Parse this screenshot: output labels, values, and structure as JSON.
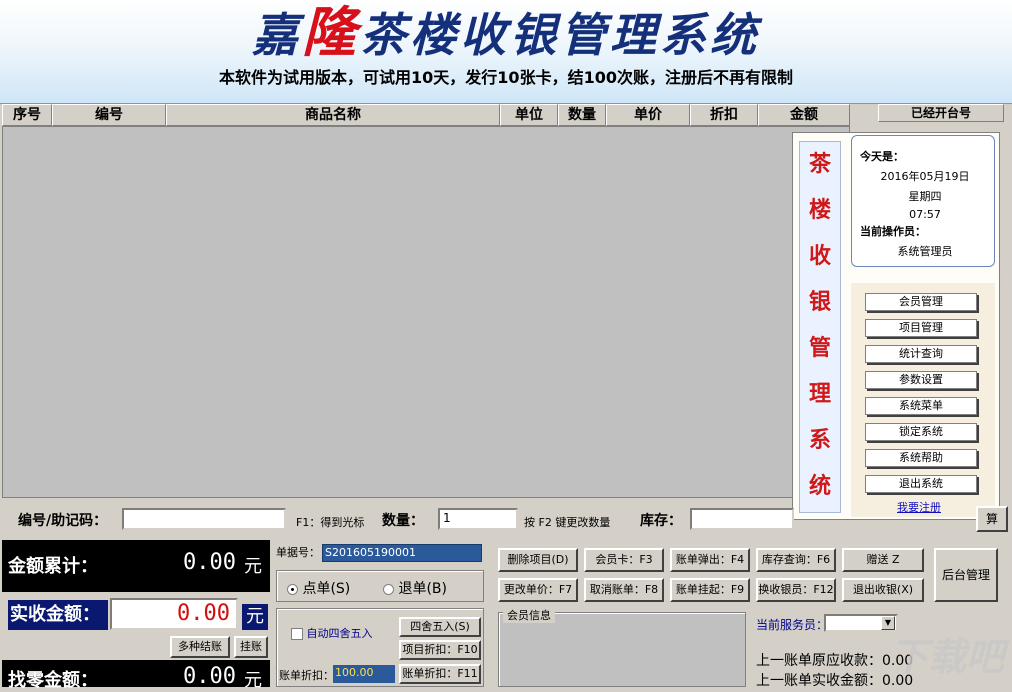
{
  "banner": {
    "title_pre": "嘉",
    "title_accent": "隆",
    "title_post": "茶楼收银管理系统",
    "subtitle": "本软件为试用版本，可试用10天，发行10张卡，结100次账，注册后不再有限制"
  },
  "grid": {
    "columns": [
      "序号",
      "编号",
      "商品名称",
      "单位",
      "数量",
      "单价",
      "折扣",
      "金额"
    ]
  },
  "open_tables_label": "已经开台号",
  "side": {
    "vertical_title": [
      "茶",
      "楼",
      "收",
      "银",
      "管",
      "理",
      "系",
      "统"
    ],
    "today_label": "今天是：",
    "date": "2016年05月19日",
    "weekday": "星期四",
    "time": "07:57",
    "operator_label": "当前操作员：",
    "operator": "系统管理员",
    "menu": [
      "会员管理",
      "项目管理",
      "统计查询",
      "参数设置",
      "系统菜单",
      "锁定系统",
      "系统帮助",
      "退出系统"
    ],
    "register_link": "我要注册"
  },
  "entry": {
    "code_label": "编号/助记码：",
    "code_value": "",
    "f1_hint": "F1：得到光标",
    "qty_label": "数量：",
    "qty_value": "1",
    "f2_hint": "按 F2 键更改数量",
    "stock_label": "库存：",
    "stock_value": "",
    "confirm_partial": "算"
  },
  "totals": {
    "sum_label": "金额累计：",
    "sum_value": "0.00",
    "unit": "元",
    "received_label": "实收金额：",
    "received_value": "0.00",
    "change_label": "找零金额：",
    "change_value": "0.00",
    "multi_pay": "多种结账",
    "hang": "挂账"
  },
  "order": {
    "order_no_label": "单据号：",
    "order_no": "S201605190001",
    "radio_order": "点单(S)",
    "radio_return": "退单(B)",
    "auto_round": "自动四舍五入",
    "round_btn": "四舍五入(S)",
    "item_discount_btn": "项目折扣：F10",
    "bill_discount_label": "账单折扣：",
    "bill_discount_value": "100.00",
    "bill_discount_btn": "账单折扣：F11"
  },
  "actions": {
    "row1": [
      "删除项目(D)",
      "会员卡：F3",
      "账单弹出：F4",
      "库存查询：F6",
      "赠送 Z"
    ],
    "row2": [
      "更改单价：F7",
      "取消账单：F8",
      "账单挂起：F9",
      "换收银员：F12",
      "退出收银(X)"
    ],
    "backend": "后台管理"
  },
  "member_info_label": "会员信息",
  "service": {
    "label": "当前服务员：",
    "value": "",
    "last_due": "上一账单原应收款：0.00",
    "last_received": "上一账单实收金额：0.00"
  },
  "watermark": "下载吧"
}
